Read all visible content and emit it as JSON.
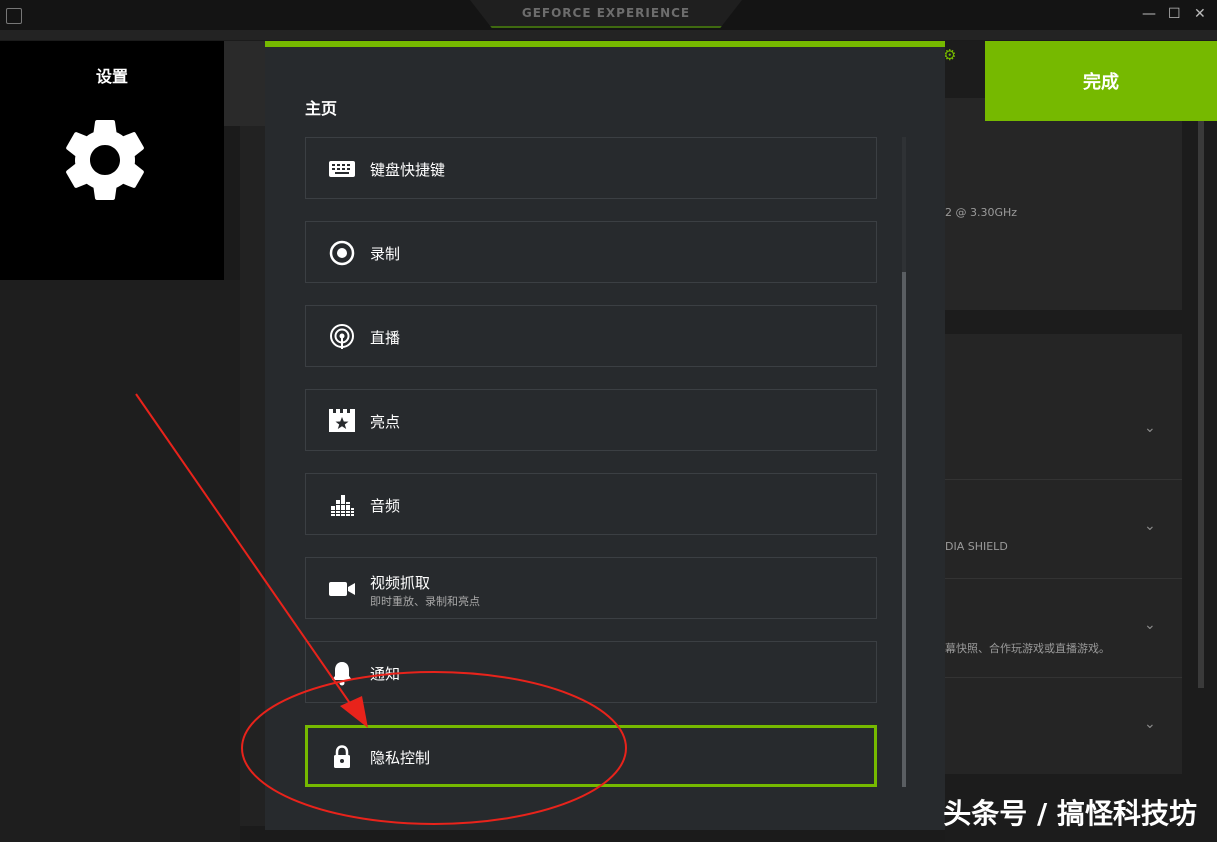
{
  "window": {
    "brand": "GEFORCE EXPERIENCE",
    "minimize_icon": "—",
    "maximize_icon": "☐",
    "close_icon": "✕"
  },
  "left_panel": {
    "title": "设置",
    "icon": "gear-icon"
  },
  "header": {
    "done_label": "完成"
  },
  "modal": {
    "title": "主页",
    "items": [
      {
        "label": "键盘快捷键",
        "icon": "keyboard-icon"
      },
      {
        "label": "录制",
        "icon": "record-icon"
      },
      {
        "label": "直播",
        "icon": "broadcast-icon"
      },
      {
        "label": "亮点",
        "icon": "highlight-icon"
      },
      {
        "label": "音频",
        "icon": "audio-icon"
      },
      {
        "label": "视频抓取",
        "sublabel": "即时重放、录制和亮点",
        "icon": "video-icon"
      },
      {
        "label": "通知",
        "icon": "bell-icon"
      },
      {
        "label": "隐私控制",
        "icon": "lock-icon",
        "selected": true
      }
    ]
  },
  "background": {
    "cpu_text": "2 @ 3.30GHz",
    "shield_text": "DIA SHIELD",
    "feature_text": "幕快照、合作玩游戏或直播游戏。"
  },
  "watermark": "头条号 / 搞怪科技坊",
  "colors": {
    "accent": "#76b900",
    "annotation": "#e8231b"
  }
}
